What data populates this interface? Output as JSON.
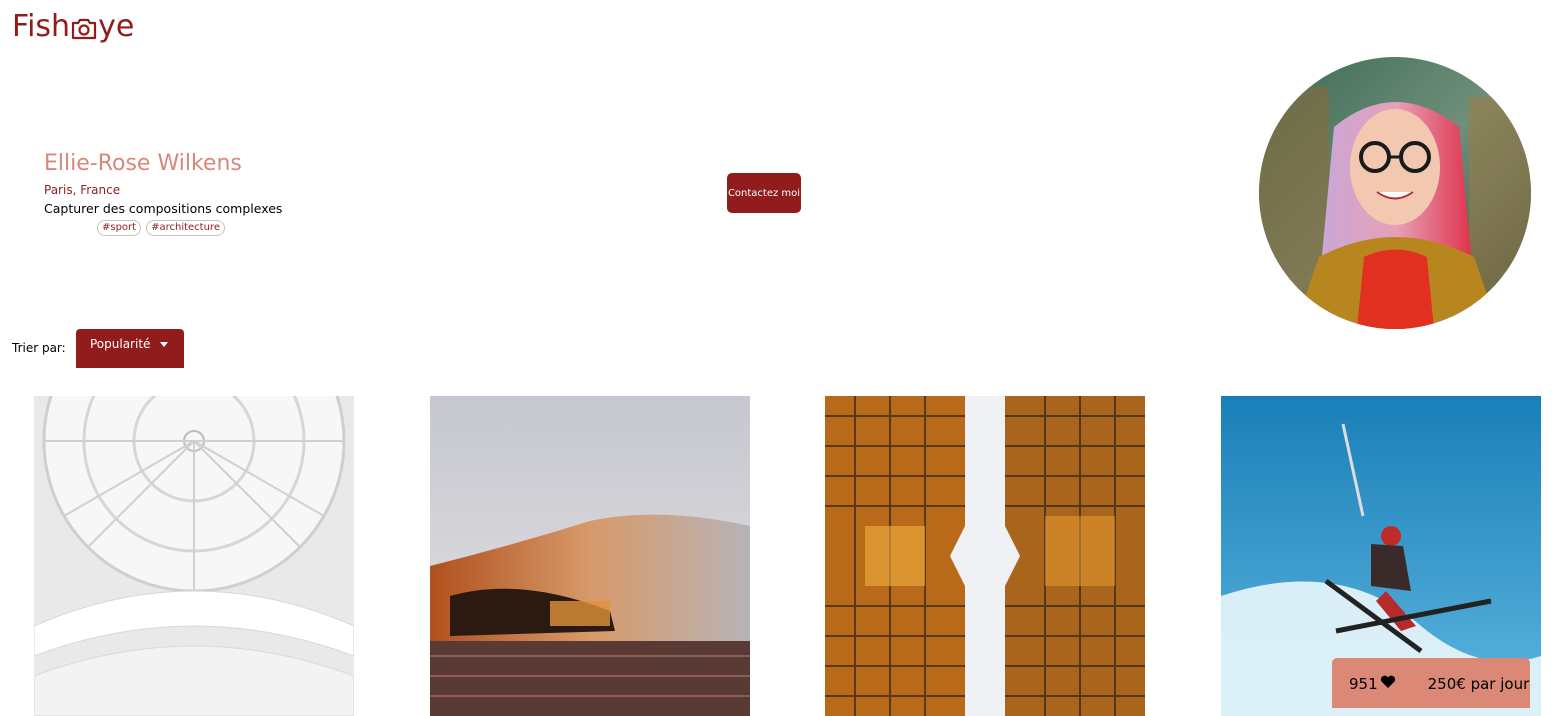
{
  "header": {
    "logo_left": "Fish",
    "logo_right": "ye",
    "logo_icon": "camera-icon"
  },
  "photographer": {
    "name": "Ellie-Rose Wilkens",
    "location": "Paris, France",
    "tagline": "Capturer des compositions complexes",
    "tags": [
      "#sport",
      "#architecture"
    ],
    "contact_label": "Contactez moi"
  },
  "sort": {
    "label": "Trier par:",
    "selected": "Popularité"
  },
  "footer_box": {
    "likes": "951",
    "price": "250€ par jour",
    "heart_icon": "heart-icon"
  },
  "colors": {
    "brand": "#901C1C",
    "accent": "#D3573C",
    "footer_bg": "#DB8876"
  }
}
